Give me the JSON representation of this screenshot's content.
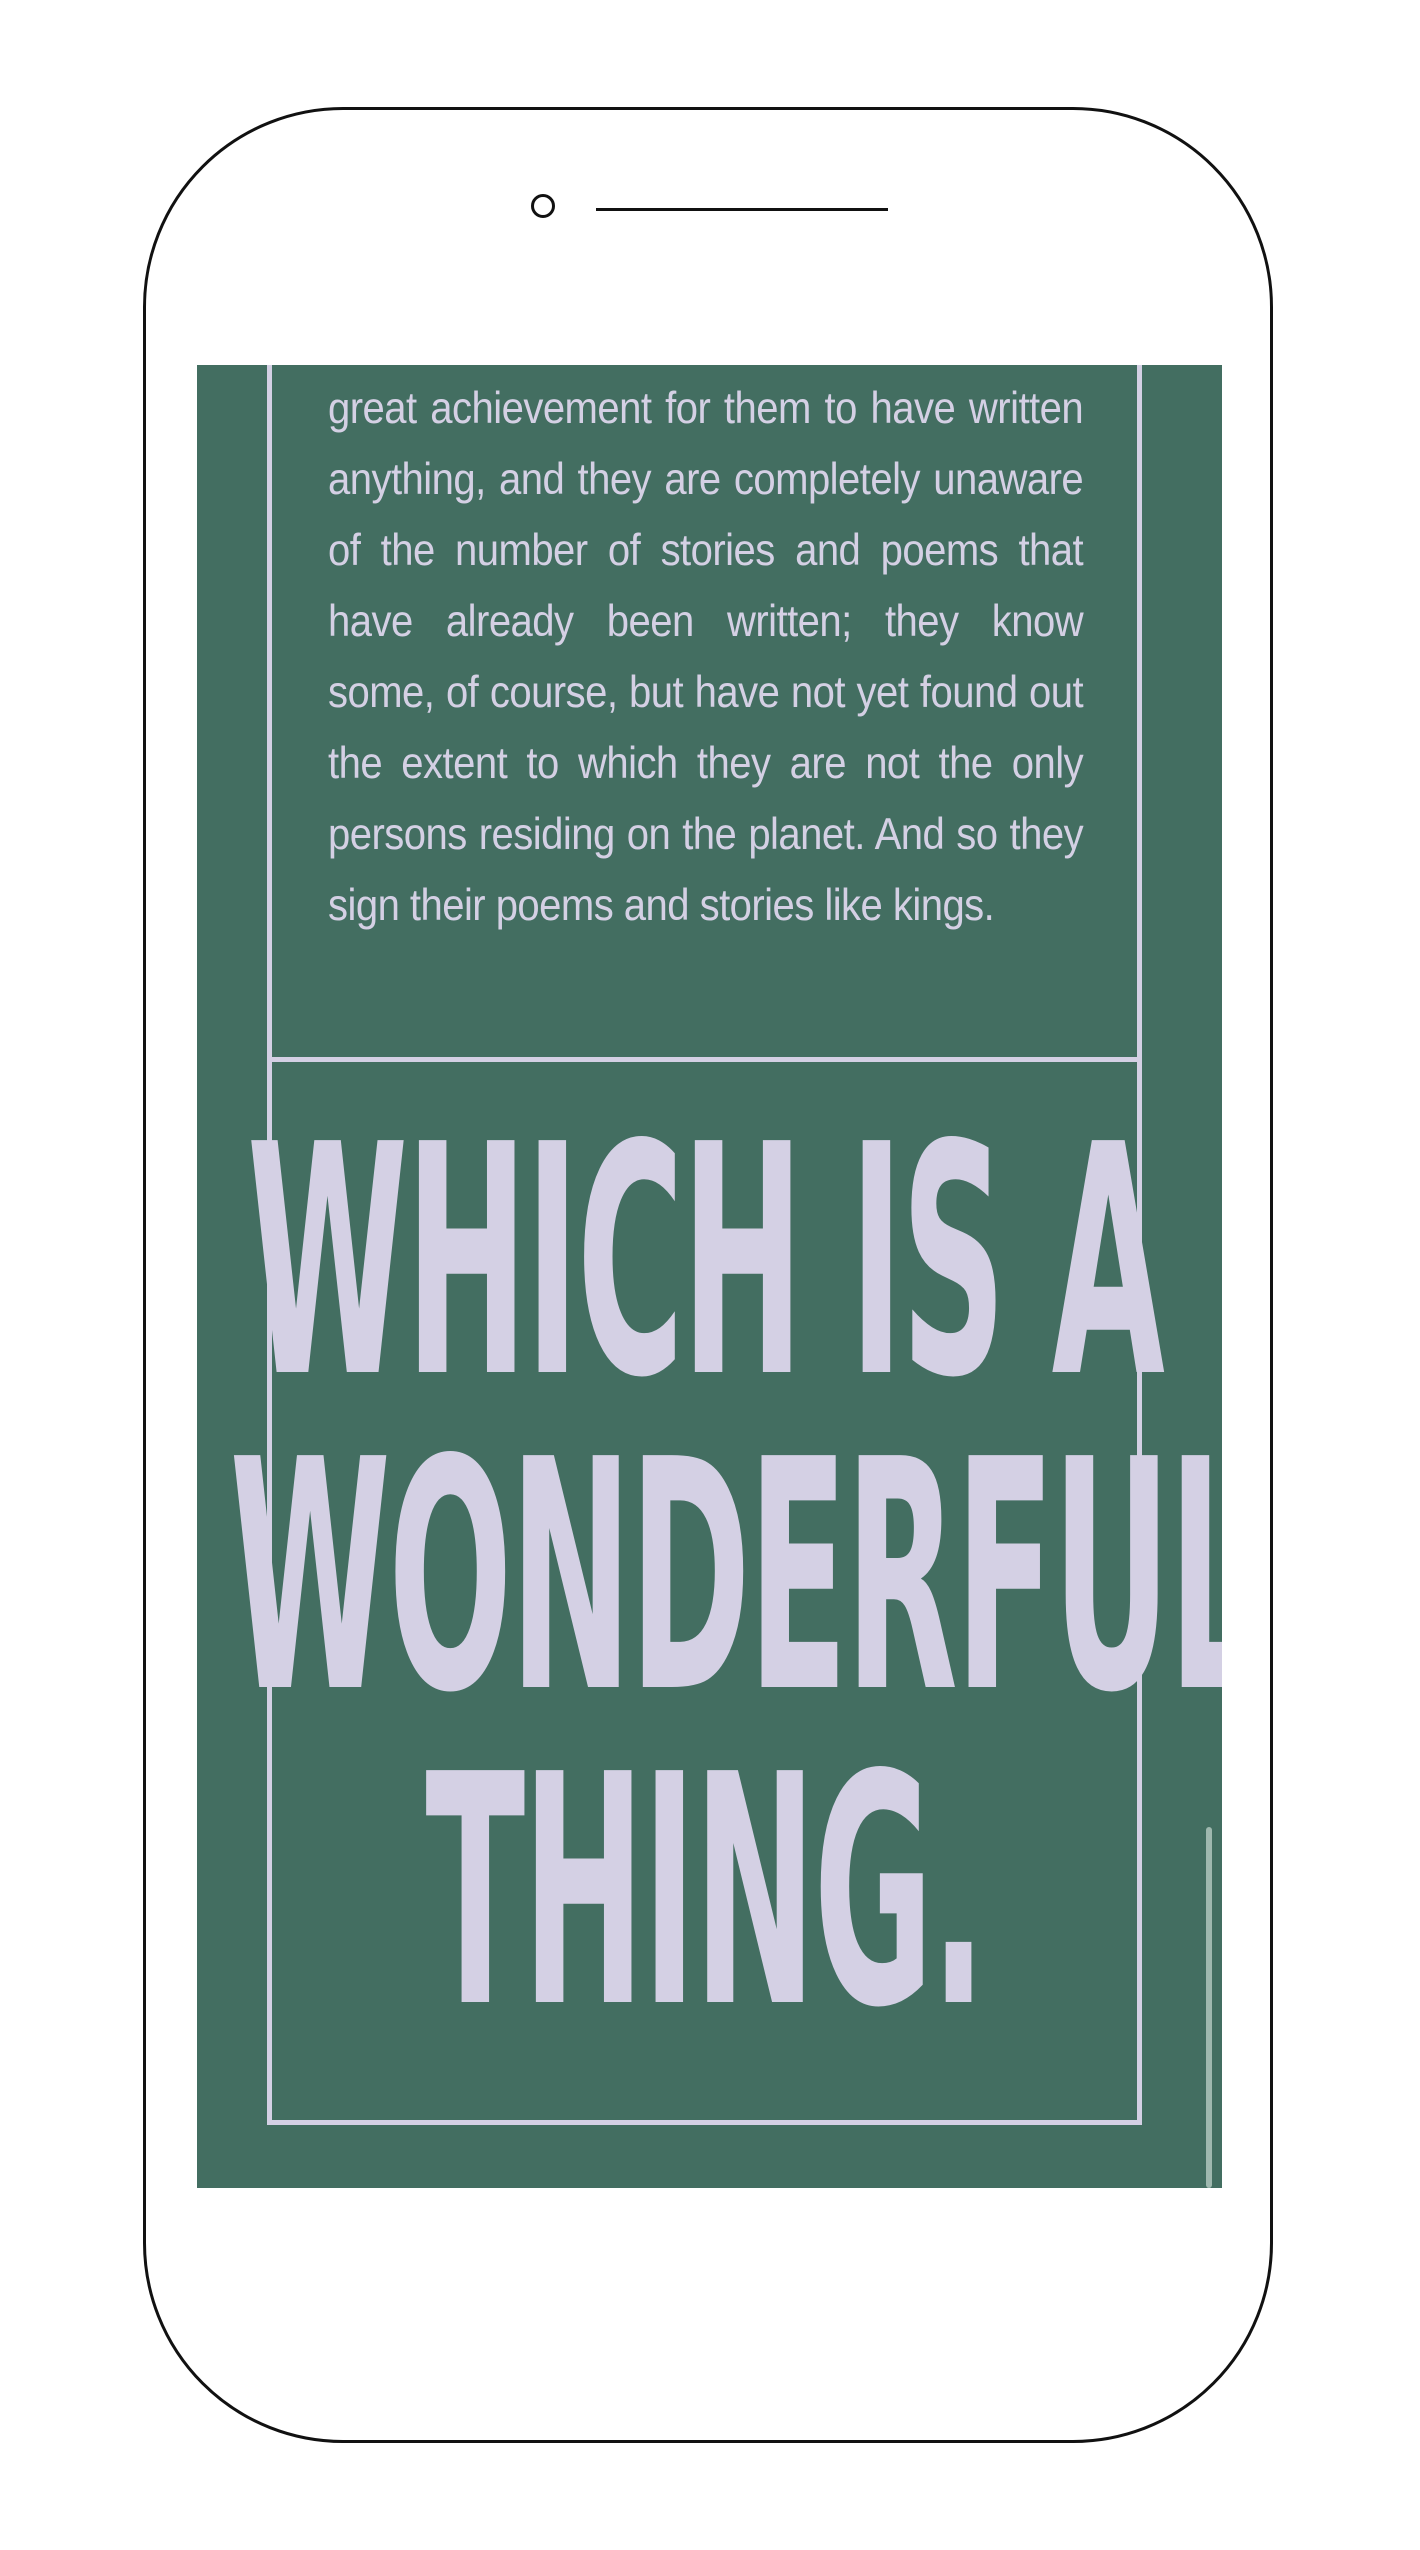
{
  "article": {
    "body_text": "great achievement for them to have written anything, and they are completely unaware of the number of stories and poems that have already been written; they know some, of course, but have not yet found out the extent to which they are not the only persons residing on the planet. And so they sign their poems and stories like kings.",
    "headline_lines": [
      "WHICH IS A",
      "WONDERFUL",
      "THING."
    ]
  },
  "colors": {
    "background": "#436e61",
    "text": "#d4d0e4",
    "frame": "#d4d0e4",
    "phone_outline": "#111111"
  },
  "icons": {
    "camera": "camera-icon",
    "speaker": "speaker-icon"
  }
}
